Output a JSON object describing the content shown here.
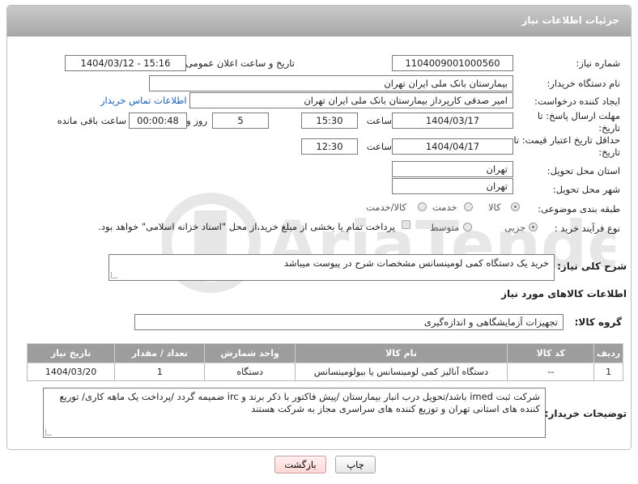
{
  "header": {
    "title": "جزئیات اطلاعات نیاز"
  },
  "fields": {
    "need_number_label": "شماره نیاز:",
    "need_number": "1104009001000560",
    "announce_label": "تاریخ و ساعت اعلان عمومی:",
    "announce_value": "1404/03/12 - 15:16",
    "buyer_org_label": "نام دستگاه خریدار:",
    "buyer_org": "بیمارستان بانک ملی ایران تهران",
    "creator_label": "ایجاد کننده درخواست:",
    "creator": "امیر صدقی کارپرداز بیمارستان بانک ملی ایران تهران",
    "contact_link": "اطلاعات تماس خریدار",
    "deadline_label": "مهلت ارسال پاسخ: تا تاریخ:",
    "deadline_date": "1404/03/17",
    "time_label": "ساعت",
    "deadline_time": "15:30",
    "days_value": "5",
    "days_label": "روز و",
    "remaining_time": "00:00:48",
    "remaining_label": "ساعت باقی مانده",
    "validity_label": "حداقل تاریخ اعتبار قیمت: تا تاریخ:",
    "validity_date": "1404/04/17",
    "validity_time": "12:30",
    "province_label": "استان محل تحویل:",
    "province": "تهران",
    "city_label": "شهر محل تحویل:",
    "city": "تهران",
    "category_label": "طبقه بندی موضوعی:",
    "category_options": [
      "کالا",
      "خدمت",
      "کالا/خدمت"
    ],
    "process_label": "نوع فرآیند خرید :",
    "process_options": [
      "جزیی",
      "متوسط"
    ],
    "payment_note": "پرداخت تمام یا بخشی از مبلغ خرید،از محل \"اسناد خزانه اسلامی\" خواهد بود."
  },
  "description": {
    "label": "شرح کلی نیاز:",
    "text": "خرید یک دستگاه کمی لومینسانس مشخصات شرح در پیوست میباشد"
  },
  "goods_info": {
    "title": "اطلاعات کالاهای مورد نیاز",
    "group_label": "گروه کالا:",
    "group_value": "تجهیزات آزمایشگاهی و اندازه‌گیری"
  },
  "table": {
    "headers": [
      "ردیف",
      "کد کالا",
      "نام کالا",
      "واحد شمارش",
      "تعداد / مقدار",
      "تاریخ نیاز"
    ],
    "rows": [
      [
        "1",
        "--",
        "دستگاه آنالیز کمی لومینسانس یا بیولومینسانس",
        "دستگاه",
        "1",
        "1404/03/20"
      ]
    ]
  },
  "buyer_notes": {
    "label": "توضیحات خریدار:",
    "text": "شرکت ثبت imed باشد/تحویل درب انبار بیمارستان /پیش فاکتور با ذکر برند و irc ضمیمه گردد /پرداخت یک ماهه کاری/ توریع کننده های استانی تهران و توزیع کننده های سراسری مجاز به شرکت هستند"
  },
  "buttons": {
    "print": "چاپ",
    "back": "بازگشت"
  },
  "colors": {
    "header_bg": "#a8a8a8",
    "table_header": "#9d9d9d",
    "link": "#1a5fb4"
  }
}
